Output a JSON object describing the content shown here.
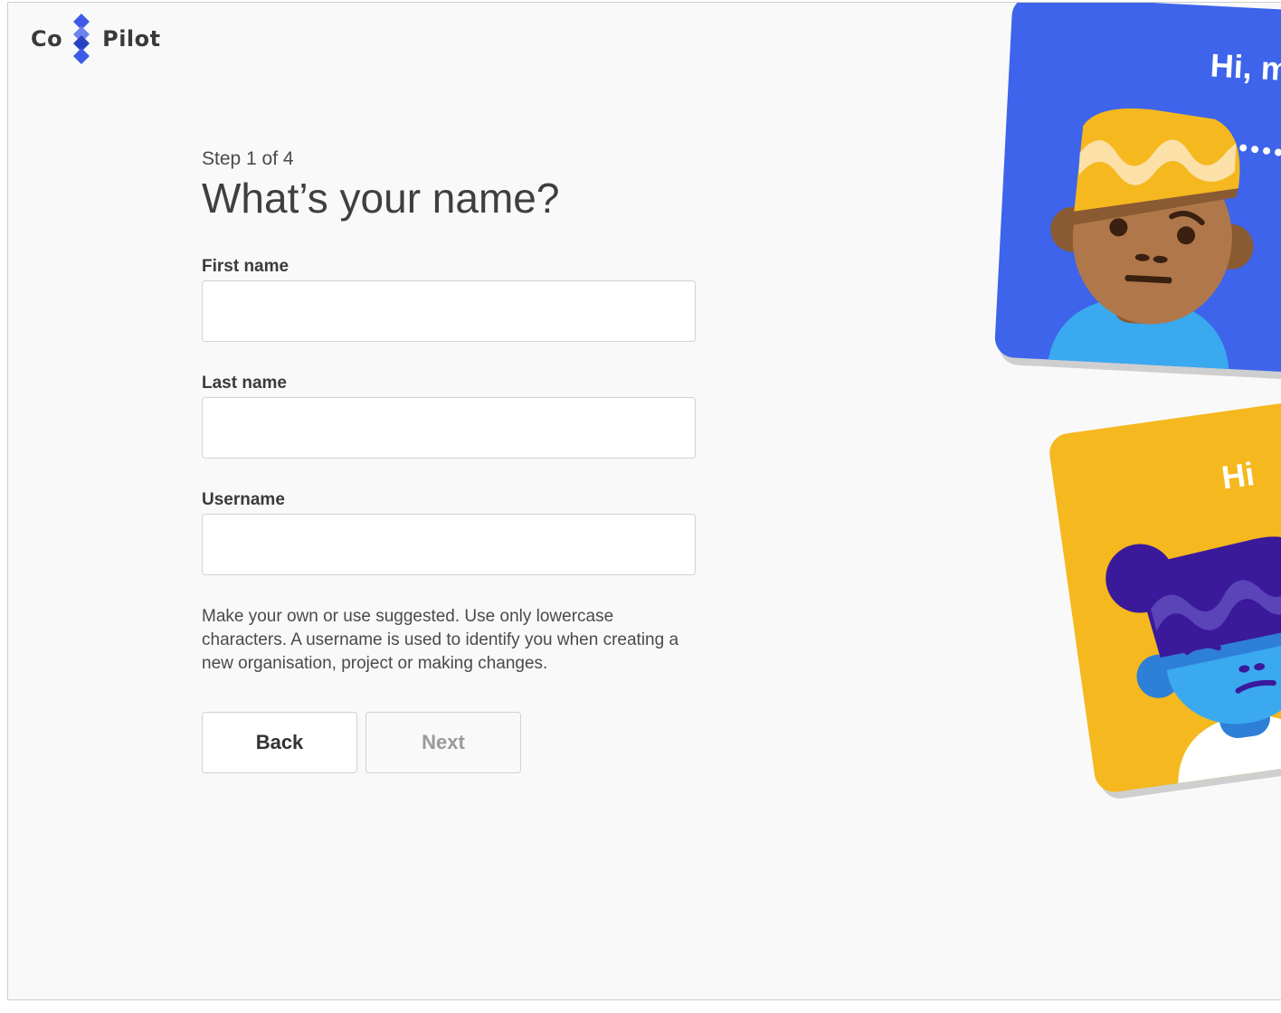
{
  "brand": {
    "left": "Co",
    "right": "Pilot",
    "colors": {
      "primary": "#3d5be8",
      "dark": "#2942c4",
      "light": "#6b82f0"
    }
  },
  "form": {
    "step": "Step 1 of 4",
    "title": "What’s your name?",
    "first_name": {
      "label": "First name",
      "value": ""
    },
    "last_name": {
      "label": "Last name",
      "value": ""
    },
    "username": {
      "label": "Username",
      "value": ""
    },
    "hint": "Make your own or use suggested. Use only lowercase characters. A username is used to identify you when creating a new organisation, project or making changes."
  },
  "buttons": {
    "back": "Back",
    "next": "Next",
    "next_disabled": true
  },
  "illustration": {
    "card1": {
      "greeting": "Hi, m",
      "background": "#3d64ea"
    },
    "card2": {
      "greeting": "Hi",
      "background": "#f5b81e"
    }
  }
}
